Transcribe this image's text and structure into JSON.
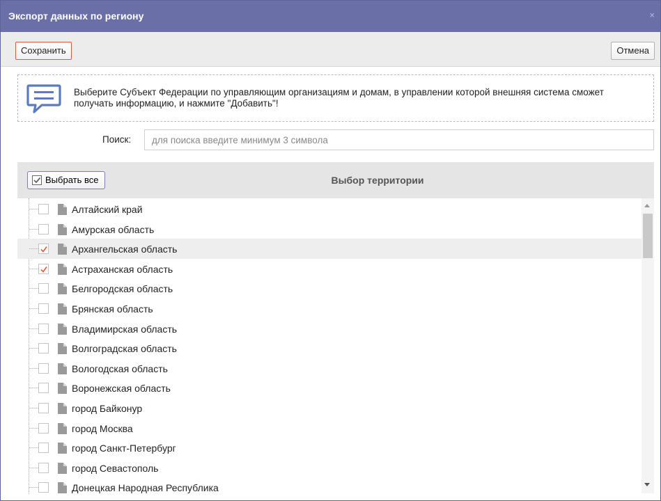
{
  "dialog": {
    "title": "Экспорт данных по региону",
    "close_glyph": "×"
  },
  "toolbar": {
    "save_label": "Сохранить",
    "cancel_label": "Отмена"
  },
  "notice": {
    "icon": "message-icon",
    "text": "Выберите Субъект Федерации по управляющим организациям и домам, в управлении которой внешняя система сможет получать информацию, и нажмите \"Добавить\"!"
  },
  "search": {
    "label": "Поиск:",
    "value": "",
    "placeholder": "для поиска введите минимум 3 символа"
  },
  "panel": {
    "select_all_label": "Выбрать все",
    "title": "Выбор территории"
  },
  "regions": [
    {
      "label": "Алтайский край",
      "checked": false,
      "selected": false
    },
    {
      "label": "Амурская область",
      "checked": false,
      "selected": false
    },
    {
      "label": "Архангельская область",
      "checked": true,
      "selected": true
    },
    {
      "label": "Астраханская область",
      "checked": true,
      "selected": false
    },
    {
      "label": "Белгородская область",
      "checked": false,
      "selected": false
    },
    {
      "label": "Брянская область",
      "checked": false,
      "selected": false
    },
    {
      "label": "Владимирская область",
      "checked": false,
      "selected": false
    },
    {
      "label": "Волгоградская область",
      "checked": false,
      "selected": false
    },
    {
      "label": "Вологодская область",
      "checked": false,
      "selected": false
    },
    {
      "label": "Воронежская область",
      "checked": false,
      "selected": false
    },
    {
      "label": "город Байконур",
      "checked": false,
      "selected": false
    },
    {
      "label": "город Москва",
      "checked": false,
      "selected": false
    },
    {
      "label": "город Санкт-Петербург",
      "checked": false,
      "selected": false
    },
    {
      "label": "город Севастополь",
      "checked": false,
      "selected": false
    },
    {
      "label": "Донецкая Народная Республика",
      "checked": false,
      "selected": false
    }
  ],
  "colors": {
    "titlebar": "#6a6fa7",
    "checkmark": "#e0593a",
    "save_border": "#e0593a",
    "notice_icon": "#5b7bbf"
  }
}
